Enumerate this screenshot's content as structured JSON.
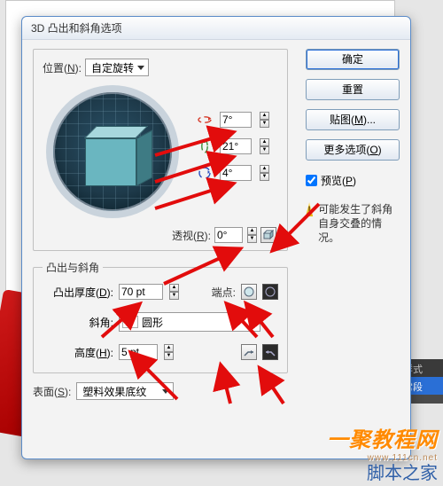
{
  "dialog": {
    "title": "3D 凸出和斜角选项",
    "position_group": {
      "legend_prefix": "位置(",
      "legend_u": "N",
      "legend_suffix": "):",
      "dropdown_value": "自定旋转",
      "rot_x": "7°",
      "rot_y": "21°",
      "rot_z": "4°",
      "persp_label_prefix": "透视(",
      "persp_label_u": "R",
      "persp_label_suffix": "):",
      "persp_value": "0°"
    },
    "extrude_group": {
      "legend": "凸出与斜角",
      "depth_label_prefix": "凸出厚度(",
      "depth_label_u": "D",
      "depth_label_suffix": "):",
      "depth_value": "70 pt",
      "cap_label": "端点:",
      "bevel_label": "斜角:",
      "bevel_value": "圆形",
      "height_label_prefix": "高度(",
      "height_label_u": "H",
      "height_label_suffix": "):",
      "height_value": "5 pt"
    },
    "surface": {
      "label_prefix": "表面(",
      "label_u": "S",
      "label_suffix": "):",
      "value": "塑料效果底纹"
    },
    "buttons": {
      "ok": "确定",
      "reset": "重置",
      "map_prefix": "贴图(",
      "map_u": "M",
      "map_suffix": ")...",
      "more_prefix": "更多选项(",
      "more_u": "O",
      "more_suffix": ")",
      "preview_prefix": "预览(",
      "preview_u": "P",
      "preview_suffix": ")",
      "warning": "可能发生了斜角自身交叠的情况。"
    }
  },
  "bg_tabs": {
    "tab1": "符样式",
    "tab2": "正常段"
  },
  "watermark1": {
    "text": "一聚教程网",
    "url": "www.111cn.net"
  },
  "watermark2": "脚本之家",
  "icons": {
    "rot_x_color": "#d63b2a",
    "rot_y_color": "#3a8f3a",
    "rot_z_color": "#2a4fbf"
  }
}
